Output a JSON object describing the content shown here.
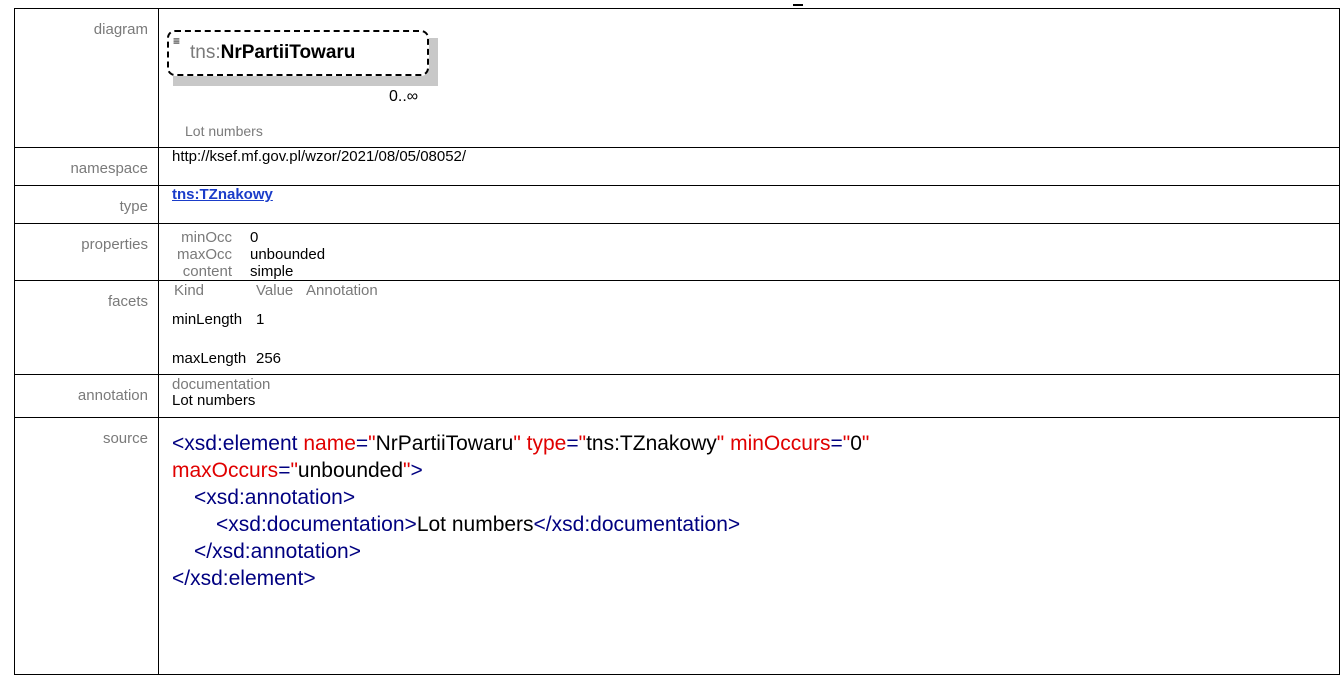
{
  "labels": {
    "diagram": "diagram",
    "namespace": "namespace",
    "type": "type",
    "properties": "properties",
    "facets": "facets",
    "annotation": "annotation",
    "source": "source"
  },
  "diagram": {
    "prefix": "tns:",
    "element_name": "NrPartiiTowaru",
    "occurrence": "0..∞",
    "doc_caption": "Lot numbers"
  },
  "namespace": "http://ksef.mf.gov.pl/wzor/2021/08/05/08052/",
  "type_link": "tns:TZnakowy",
  "properties": [
    {
      "key": "minOcc",
      "value": "0"
    },
    {
      "key": "maxOcc",
      "value": "unbounded"
    },
    {
      "key": "content",
      "value": "simple"
    }
  ],
  "facets": {
    "headers": [
      "Kind",
      "Value",
      "Annotation"
    ],
    "rows": [
      {
        "kind": "minLength",
        "value": "1"
      },
      {
        "kind": "maxLength",
        "value": "256"
      }
    ]
  },
  "annotation": {
    "title": "documentation",
    "text": "Lot numbers"
  },
  "source": {
    "line1_open": "<xsd:element",
    "attr_name": "name",
    "attr_name_val": "NrPartiiTowaru",
    "attr_type": "type",
    "attr_type_val": "tns:TZnakowy",
    "attr_min": "minOccurs",
    "attr_min_val": "0",
    "attr_max": "maxOccurs",
    "attr_max_val": "unbounded",
    "ann_open": "<xsd:annotation>",
    "doc_open": "<xsd:documentation>",
    "doc_text": "Lot numbers",
    "doc_close": "</xsd:documentation>",
    "ann_close": "</xsd:annotation>",
    "el_close": "</xsd:element>"
  },
  "colors": {
    "label_gray": "#7a7a7a",
    "link_blue": "#1a3cc9",
    "xml_tag": "#000080",
    "xml_attr": "#e00000"
  }
}
